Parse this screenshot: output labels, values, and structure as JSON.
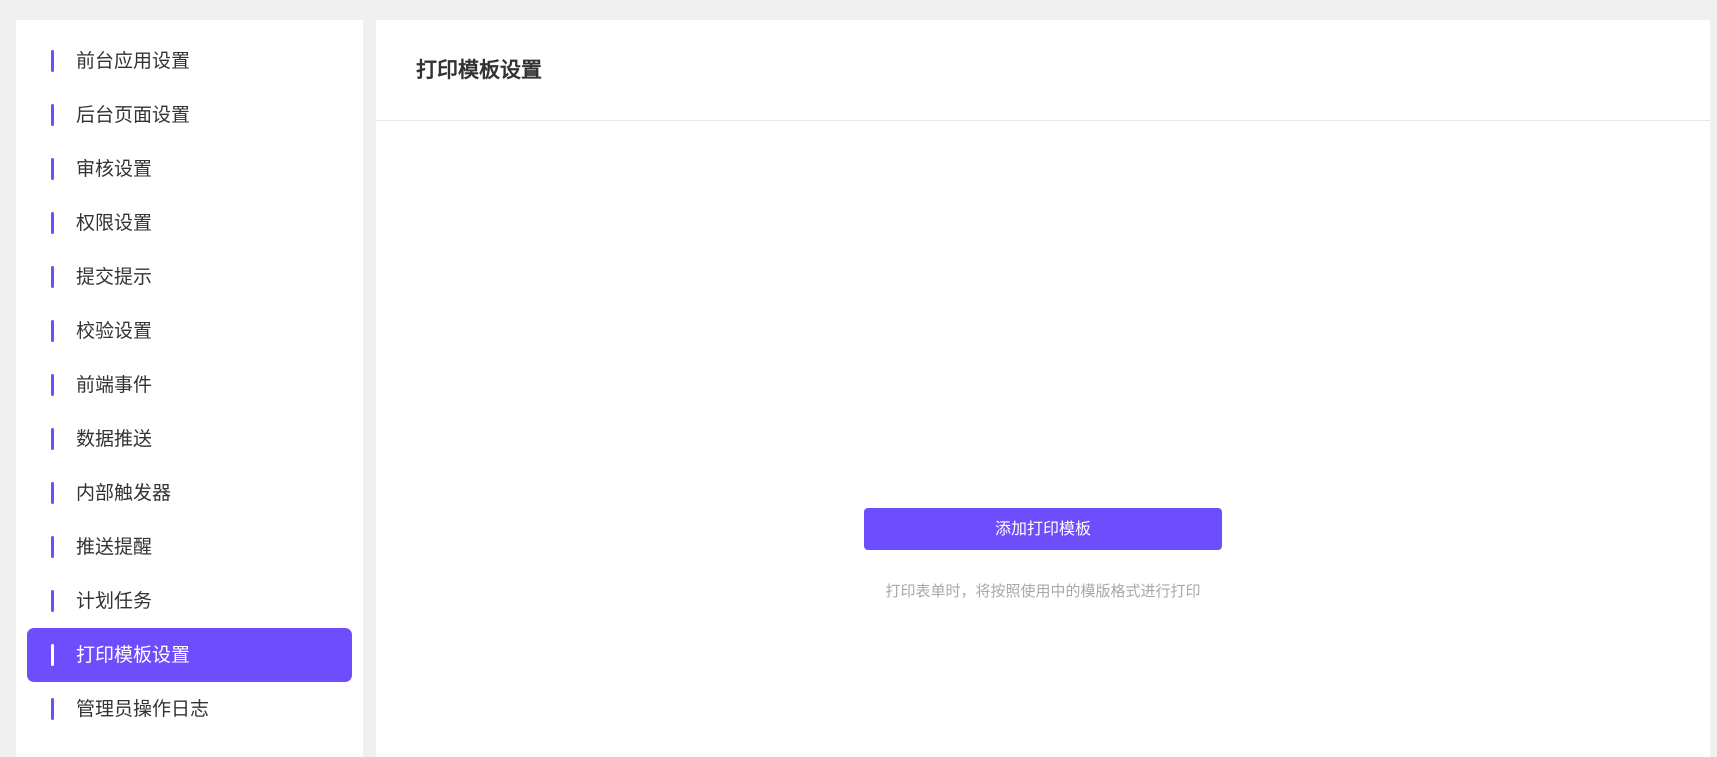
{
  "sidebar": {
    "items": [
      {
        "label": "前台应用设置",
        "active": false
      },
      {
        "label": "后台页面设置",
        "active": false
      },
      {
        "label": "审核设置",
        "active": false
      },
      {
        "label": "权限设置",
        "active": false
      },
      {
        "label": "提交提示",
        "active": false
      },
      {
        "label": "校验设置",
        "active": false
      },
      {
        "label": "前端事件",
        "active": false
      },
      {
        "label": "数据推送",
        "active": false
      },
      {
        "label": "内部触发器",
        "active": false
      },
      {
        "label": "推送提醒",
        "active": false
      },
      {
        "label": "计划任务",
        "active": false
      },
      {
        "label": "打印模板设置",
        "active": true
      },
      {
        "label": "管理员操作日志",
        "active": false
      }
    ]
  },
  "main": {
    "title": "打印模板设置",
    "add_button_label": "添加打印模板",
    "hint": "打印表单时，将按照使用中的模版格式进行打印"
  },
  "colors": {
    "accent": "#6e4dfc",
    "background": "#f0f0f0",
    "panel": "#ffffff",
    "text": "#333333",
    "hint_text": "#a8a8a8"
  }
}
